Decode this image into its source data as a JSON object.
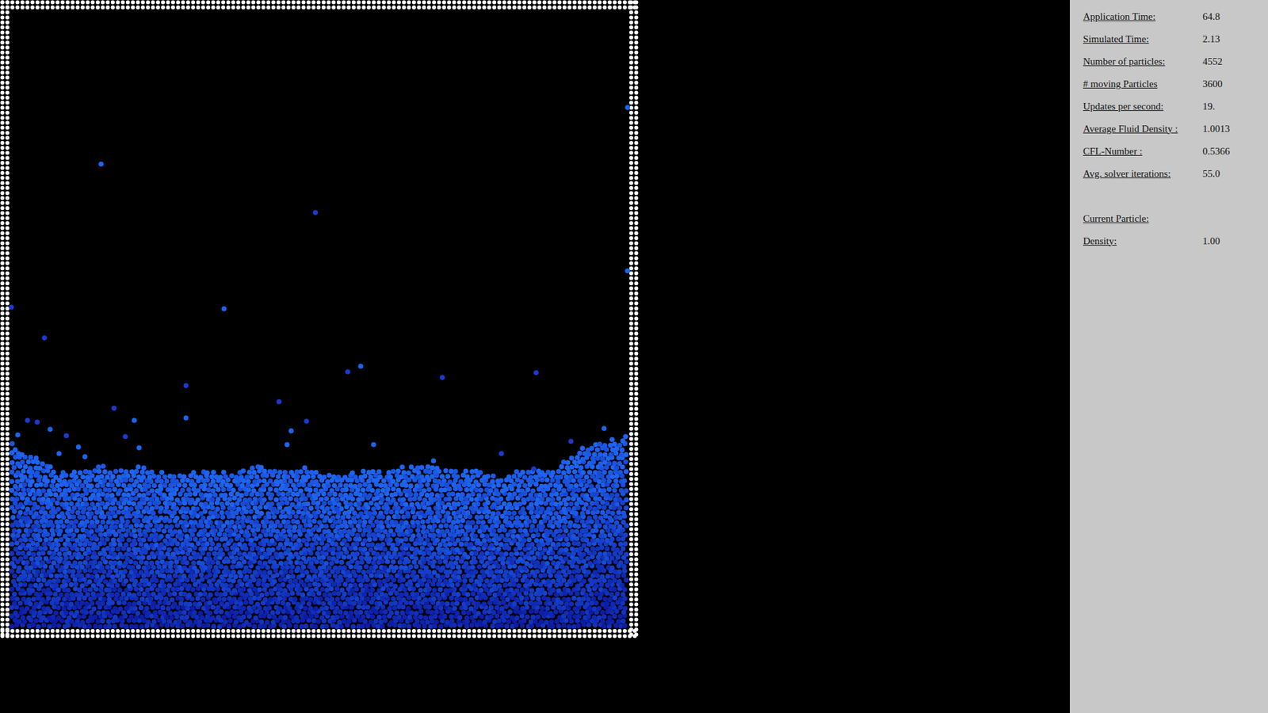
{
  "sidebar": {
    "stats": [
      {
        "label": "Application Time:",
        "value": "64.8"
      },
      {
        "label": "Simulated Time:",
        "value": "2.13"
      },
      {
        "label": "Number of particles:",
        "value": "4552"
      },
      {
        "label": "# moving Particles",
        "value": "3600"
      },
      {
        "label": "Updates per second:",
        "value": "19."
      },
      {
        "label": "Average Fluid Density :",
        "value": "1.0013"
      },
      {
        "label": "CFL-Number :",
        "value": "0.5366"
      },
      {
        "label": "Avg. solver iterations:",
        "value": "55.0"
      }
    ],
    "current_particle": {
      "heading": "Current Particle:",
      "stats": [
        {
          "label": "Density:",
          "value": "1.00"
        }
      ]
    }
  }
}
